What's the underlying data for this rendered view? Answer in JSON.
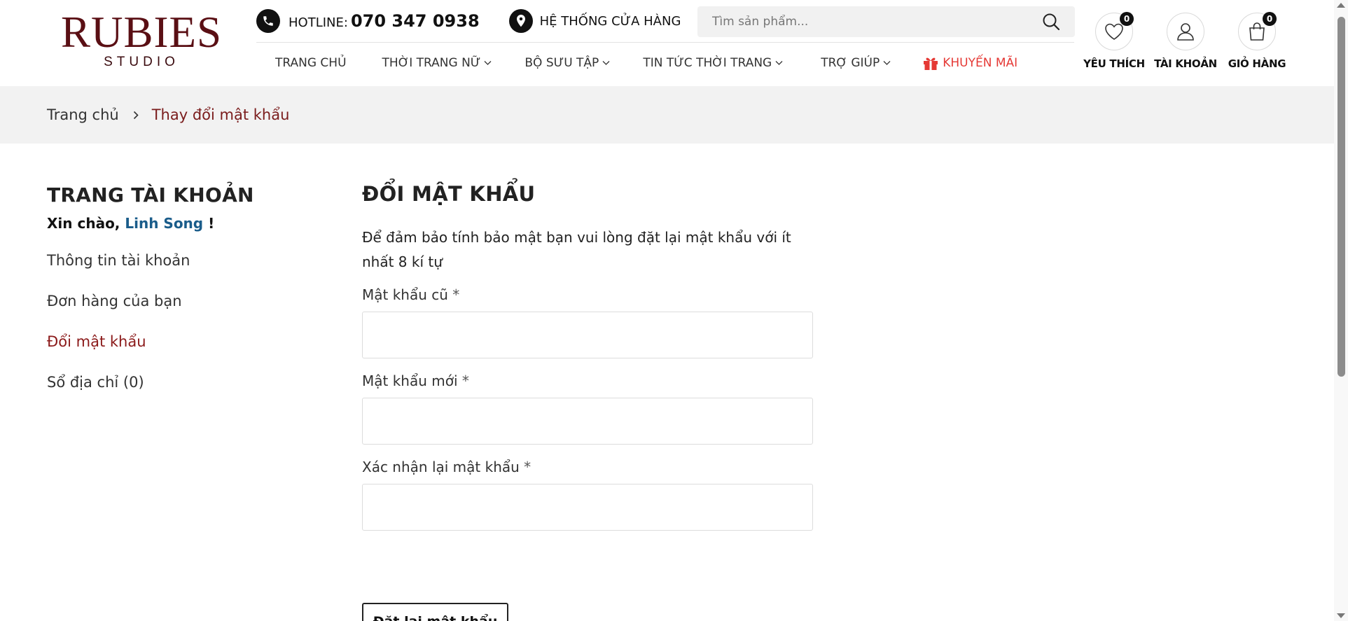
{
  "brand": {
    "logo_main": "RUBIES",
    "logo_sub": "STUDIO",
    "color": "#5a0f14"
  },
  "topbar": {
    "hotline_label": "HOTLINE:",
    "hotline_number": "070 347 0938",
    "stores_label": "HỆ THỐNG CỬA HÀNG",
    "search_placeholder": "Tìm sản phẩm..."
  },
  "nav": {
    "items": [
      {
        "label": "TRANG CHỦ",
        "dropdown": false
      },
      {
        "label": "THỜI TRANG NỮ",
        "dropdown": true
      },
      {
        "label": "BỘ SƯU TẬP",
        "dropdown": true
      },
      {
        "label": "TIN TỨC THỜI TRANG",
        "dropdown": true
      },
      {
        "label": "TRỢ GIÚP",
        "dropdown": true
      }
    ],
    "promo_label": "KHUYẾN MÃI",
    "promo_color": "#e53935"
  },
  "account": {
    "wishlist_label": "YÊU THÍCH",
    "wishlist_count": "0",
    "account_label": "TÀI KHOẢN",
    "cart_label": "GIỎ HÀNG",
    "cart_count": "0"
  },
  "breadcrumb": {
    "home": "Trang chủ",
    "current": "Thay đổi mật khẩu"
  },
  "sidebar": {
    "title": "TRANG TÀI KHOẢN",
    "greeting_prefix": "Xin chào,",
    "user_name": "Linh Song",
    "greeting_suffix": "!",
    "links": [
      {
        "label": "Thông tin tài khoản",
        "active": false
      },
      {
        "label": "Đơn hàng của bạn",
        "active": false
      },
      {
        "label": "Đổi mật khẩu",
        "active": true
      },
      {
        "label": "Sổ địa chỉ (0)",
        "active": false
      }
    ]
  },
  "form": {
    "title": "ĐỔI MẬT KHẨU",
    "description": "Để đảm bảo tính bảo mật bạn vui lòng đặt lại mật khẩu với ít nhất 8 kí tự",
    "old_password_label": "Mật khẩu cũ",
    "new_password_label": "Mật khẩu mới",
    "confirm_password_label": "Xác nhận lại mật khẩu",
    "required_mark": "*",
    "old_password_value": "",
    "new_password_value": "",
    "confirm_password_value": "",
    "submit_label": "Đặt lại mật khẩu"
  }
}
